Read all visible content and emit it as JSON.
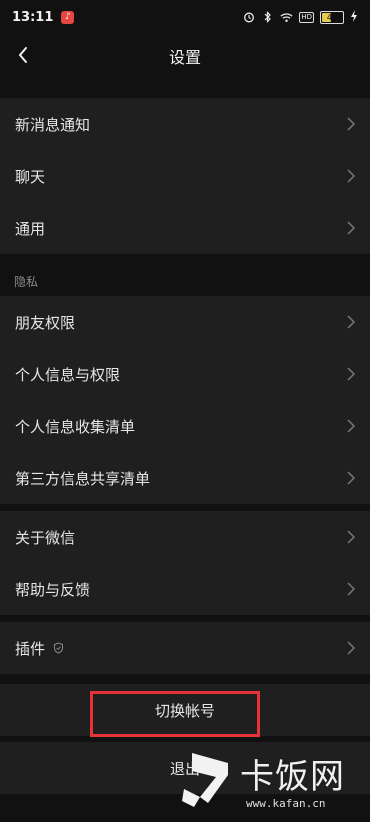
{
  "status_bar": {
    "time": "13:11",
    "app_badge": "♪",
    "hd": "HD",
    "battery": "44",
    "battery_level": 0.44,
    "battery_color": "#e6c84a"
  },
  "header": {
    "title": "设置"
  },
  "groups": [
    {
      "items": [
        {
          "label": "新消息通知"
        },
        {
          "label": "聊天"
        },
        {
          "label": "通用"
        }
      ]
    },
    {
      "section": "隐私",
      "items": [
        {
          "label": "朋友权限"
        },
        {
          "label": "个人信息与权限"
        },
        {
          "label": "个人信息收集清单"
        },
        {
          "label": "第三方信息共享清单"
        }
      ]
    },
    {
      "items": [
        {
          "label": "关于微信"
        },
        {
          "label": "帮助与反馈"
        }
      ]
    },
    {
      "items": [
        {
          "label": "插件"
        }
      ]
    }
  ],
  "actions": {
    "switch_account": "切换帐号",
    "logout": "退出"
  },
  "watermark": {
    "brand": "卡饭网",
    "url": "www.kafan.cn"
  },
  "colors": {
    "highlight": "#e8323a",
    "background": "#111111",
    "row": "#1f1f1f"
  }
}
